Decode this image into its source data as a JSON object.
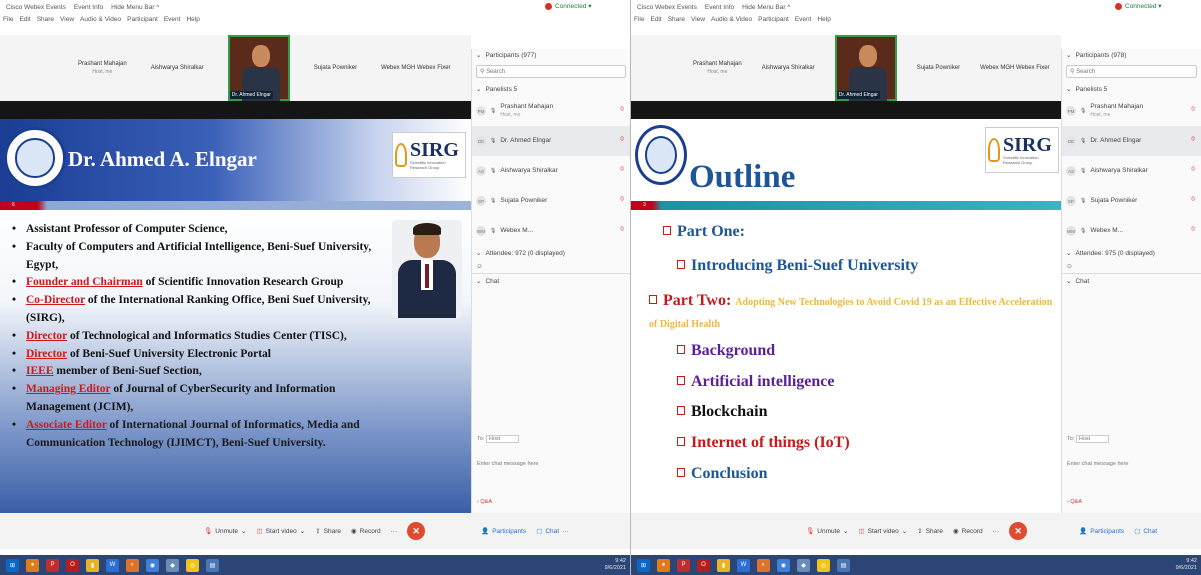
{
  "left": {
    "titlebar": [
      "Cisco Webex Events",
      "Event Info",
      "Hide Menu Bar ^"
    ],
    "connection": "Connected ▾",
    "menu": [
      "File",
      "Edit",
      "Share",
      "View",
      "Audio & Video",
      "Participant",
      "Event",
      "Help"
    ],
    "videos": [
      {
        "name": "Prashant Mahajan",
        "sub": "Host, me"
      },
      {
        "name": "Aishwarya Shiralkar",
        "sub": ""
      },
      {
        "name": "Dr. Ahmed Elngar",
        "sub": ""
      },
      {
        "name": "Sujata Powniker",
        "sub": ""
      },
      {
        "name": "Webex MGH Webex Fixer",
        "sub": ""
      }
    ],
    "slide": {
      "title": "Dr. Ahmed A. Elngar",
      "sirg": "SIRG",
      "sirg_sub": "Scientific Innovation Research Group",
      "page_num": "6",
      "bullets": [
        [
          {
            "t": "Assistant Professor of Computer Science,",
            "s": "n"
          }
        ],
        [
          {
            "t": "Faculty of Computers and Artificial Intelligence, Beni-Suef University, Egypt,",
            "s": "n"
          }
        ],
        [
          {
            "t": "Founder and Chairman",
            "s": "u"
          },
          {
            "t": " of Scientific Innovation Research Group",
            "s": "n"
          }
        ],
        [
          {
            "t": "Co-Director",
            "s": "u"
          },
          {
            "t": " of the International Ranking Office, Beni Suef University, (SIRG),",
            "s": "n"
          }
        ],
        [
          {
            "t": "Director",
            "s": "u"
          },
          {
            "t": " of Technological and Informatics Studies Center (TISC),",
            "s": "n"
          }
        ],
        [
          {
            "t": "Director",
            "s": "u"
          },
          {
            "t": " of Beni-Suef University Electronic Portal",
            "s": "n"
          }
        ],
        [
          {
            "t": "IEEE",
            "s": "u"
          },
          {
            "t": " member of Beni-Suef Section,",
            "s": "n"
          }
        ],
        [
          {
            "t": "Managing Editor",
            "s": "u"
          },
          {
            "t": " of Journal of CyberSecurity and Information Management (JCIM),",
            "s": "n"
          }
        ],
        [
          {
            "t": "Associate Editor",
            "s": "u"
          },
          {
            "t": " of International Journal of Informatics, Media and Communication Technology (IJIMCT), Beni-Suef University.",
            "s": "w"
          }
        ]
      ]
    },
    "panel": {
      "title": "Participants (977)",
      "search": "Search",
      "panelists": "Panelists 5",
      "people": [
        {
          "ini": "PM",
          "name": "Prashant Mahajan",
          "sub": "Host, me"
        },
        {
          "ini": "DE",
          "name": "Dr. Ahmed Elngar",
          "sub": ""
        },
        {
          "ini": "AS",
          "name": "Aishwarya Shiralkar",
          "sub": ""
        },
        {
          "ini": "SP",
          "name": "Sujata Powniker",
          "sub": ""
        },
        {
          "ini": "WM",
          "name": "Webex M...",
          "sub": ""
        }
      ],
      "attendees": "Attendee: 972 (0 displayed)",
      "chat": "Chat",
      "to_label": "To:",
      "to_value": "Host",
      "chat_placeholder": "Enter chat message here",
      "qa": "Q&A"
    },
    "controls": {
      "unmute": "Unmute",
      "video": "Start video",
      "share": "Share",
      "record": "Record",
      "participants": "Participants",
      "chat": "Chat"
    },
    "clock": {
      "time": "9:42",
      "date": "9/6/2021"
    }
  },
  "right": {
    "titlebar": [
      "Cisco Webex Events",
      "Event Info",
      "Hide Menu Bar ^"
    ],
    "connection": "Connected ▾",
    "menu": [
      "File",
      "Edit",
      "Share",
      "View",
      "Audio & Video",
      "Participant",
      "Event",
      "Help"
    ],
    "videos": [
      {
        "name": "Prashant Mahajan",
        "sub": "Host, me"
      },
      {
        "name": "Aishwarya Shiralkar",
        "sub": ""
      },
      {
        "name": "Dr. Ahmed Elngar",
        "sub": ""
      },
      {
        "name": "Sujata Powniker",
        "sub": ""
      },
      {
        "name": "Webex MGH Webex Fixer",
        "sub": ""
      }
    ],
    "slide": {
      "title": "Outline",
      "sirg": "SIRG",
      "sirg_sub": "Scientific Innovation Research Group",
      "page_num": "3",
      "part_one": "Part One:",
      "introducing": "Introducing Beni-Suef University",
      "part_two": "Part Two:",
      "part_two_desc": "Adopting New Technologies to Avoid Covid 19 as an Effective Acceleration of Digital Health",
      "items": [
        "Background",
        "Artificial intelligence",
        "Blockchain",
        "Internet of things (IoT)",
        "Conclusion"
      ]
    },
    "panel": {
      "title": "Participants (978)",
      "search": "Search",
      "panelists": "Panelists 5",
      "people": [
        {
          "ini": "PM",
          "name": "Prashant Mahajan",
          "sub": "Host, me"
        },
        {
          "ini": "DE",
          "name": "Dr. Ahmed Elngar",
          "sub": ""
        },
        {
          "ini": "AS",
          "name": "Aishwarya Shiralkar",
          "sub": ""
        },
        {
          "ini": "SP",
          "name": "Sujata Powniker",
          "sub": ""
        },
        {
          "ini": "WM",
          "name": "Webex M...",
          "sub": ""
        }
      ],
      "attendees": "Attendee: 975 (0 displayed)",
      "chat": "Chat",
      "to_label": "To:",
      "to_value": "Host",
      "chat_placeholder": "Enter chat message here",
      "qa": "Q&A"
    },
    "controls": {
      "unmute": "Unmute",
      "video": "Start video",
      "share": "Share",
      "record": "Record",
      "participants": "Participants",
      "chat": "Chat"
    },
    "clock": {
      "time": "9:42",
      "date": "9/6/2021"
    }
  },
  "colors": {
    "accent_red": "#d01818",
    "title_blue": "#1d5596",
    "end_call": "#e04a2f",
    "taskbar": "#2b4576"
  }
}
